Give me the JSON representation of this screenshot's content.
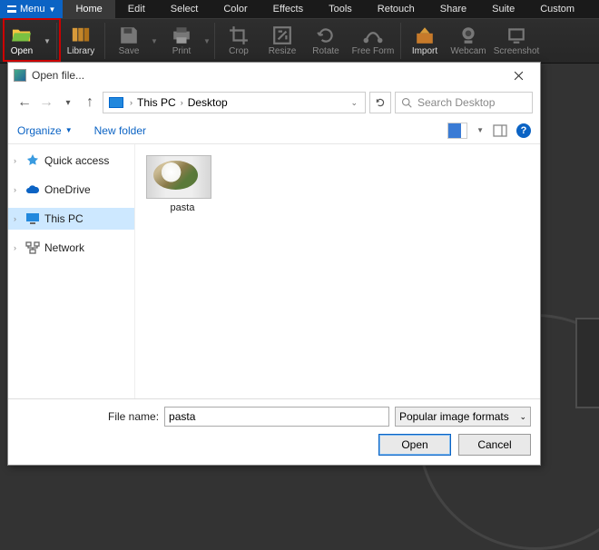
{
  "menu": {
    "label": "Menu"
  },
  "tabs": [
    "Home",
    "Edit",
    "Select",
    "Color",
    "Effects",
    "Tools",
    "Retouch",
    "Share",
    "Suite",
    "Custom"
  ],
  "ribbon": {
    "open": "Open",
    "library": "Library",
    "save": "Save",
    "print": "Print",
    "crop": "Crop",
    "resize": "Resize",
    "rotate": "Rotate",
    "freeform": "Free Form",
    "import": "Import",
    "webcam": "Webcam",
    "screenshot": "Screenshot"
  },
  "dialog": {
    "title": "Open file...",
    "path": {
      "root": "This PC",
      "folder": "Desktop"
    },
    "search_placeholder": "Search Desktop",
    "organize": "Organize",
    "newfolder": "New folder",
    "help": "?",
    "sidebar": [
      {
        "label": "Quick access",
        "icon": "star"
      },
      {
        "label": "OneDrive",
        "icon": "cloud"
      },
      {
        "label": "This PC",
        "icon": "pc",
        "selected": true
      },
      {
        "label": "Network",
        "icon": "network"
      }
    ],
    "files": [
      {
        "name": "pasta"
      }
    ],
    "filename_label": "File name:",
    "filename_value": "pasta",
    "filetype": "Popular image formats",
    "open_btn": "Open",
    "cancel_btn": "Cancel"
  }
}
